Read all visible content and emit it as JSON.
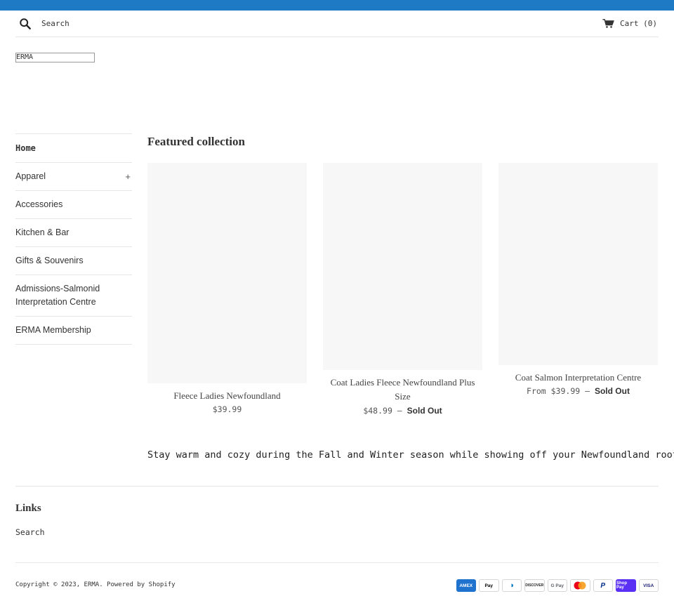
{
  "header": {
    "search_placeholder": "Search",
    "cart_label": "Cart (0)"
  },
  "logo": {
    "text": "ERMA"
  },
  "sidebar": {
    "items": [
      {
        "label": "Home",
        "has_children": false,
        "active": true
      },
      {
        "label": "Apparel",
        "has_children": true,
        "toggle": "+"
      },
      {
        "label": "Accessories",
        "has_children": false
      },
      {
        "label": "Kitchen & Bar",
        "has_children": false
      },
      {
        "label": "Gifts & Souvenirs",
        "has_children": false
      },
      {
        "label": "Admissions-Salmonid Interpretation Centre",
        "has_children": false
      },
      {
        "label": "ERMA Membership",
        "has_children": false
      }
    ]
  },
  "featured": {
    "title": "Featured collection",
    "products": [
      {
        "title": "Fleece Ladies Newfoundland",
        "price": "$39.99",
        "sold_out": ""
      },
      {
        "title": "Coat Ladies Fleece Newfoundland Plus Size",
        "price": "$48.99 —",
        "sold_out": "Sold Out"
      },
      {
        "title": "Coat Salmon Interpretation Centre",
        "price": "From $39.99 —",
        "sold_out": "Sold Out"
      }
    ],
    "description": "Stay warm and cozy during the Fall and Winter season while showing off your Newfoundland roots!"
  },
  "footer": {
    "links_title": "Links",
    "links": [
      {
        "label": "Search"
      }
    ],
    "copyright": "Copyright © 2023, ERMA. Powered by Shopify",
    "payment_methods": [
      {
        "name": "american-express",
        "label": "AMEX",
        "bg": "#1f72cd",
        "fg": "#ffffff"
      },
      {
        "name": "apple-pay",
        "label": "Pay",
        "bg": "#ffffff",
        "fg": "#000000"
      },
      {
        "name": "diners-club",
        "label": "◑",
        "bg": "#ffffff",
        "fg": "#0079be"
      },
      {
        "name": "discover",
        "label": "DISCOVER",
        "bg": "#ffffff",
        "fg": "#231f20"
      },
      {
        "name": "google-pay",
        "label": "G Pay",
        "bg": "#ffffff",
        "fg": "#5f6368"
      },
      {
        "name": "mastercard",
        "label": "",
        "bg": "#ffffff",
        "fg": "#eb001b"
      },
      {
        "name": "paypal",
        "label": "P",
        "bg": "#ffffff",
        "fg": "#003087"
      },
      {
        "name": "shop-pay",
        "label": "Shop Pay",
        "bg": "#5a31f4",
        "fg": "#ffffff"
      },
      {
        "name": "visa",
        "label": "VISA",
        "bg": "#ffffff",
        "fg": "#1a1f71"
      }
    ]
  },
  "colors": {
    "top_bar": "#1e7ac4",
    "product_placeholder": "#f7f7f7",
    "divider": "#e6e6e6"
  }
}
